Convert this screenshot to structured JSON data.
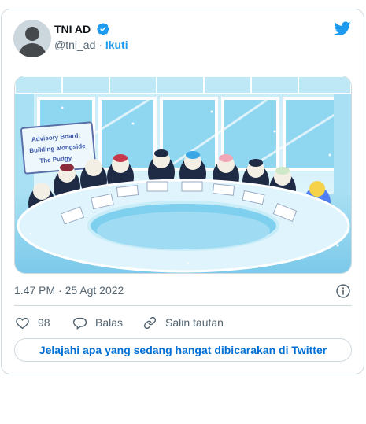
{
  "tweet": {
    "author_name": "TNI AD",
    "handle": "@tni_ad",
    "separator": "·",
    "follow_label": "Ikuti",
    "timestamp": "1.47 PM · 25 Agt 2022",
    "media": {
      "banner_text": [
        "Advisory Board:",
        "Building alongside",
        "The Pudgy"
      ]
    },
    "actions": {
      "likes_count": "98",
      "reply_label": "Balas",
      "copy_link_label": "Salin tautan"
    },
    "explore_label": "Jelajahi apa yang sedang hangat dibicarakan di Twitter"
  },
  "icons": {
    "verified": "verified-badge-icon",
    "logo": "twitter-bird-icon",
    "info": "info-icon",
    "like": "heart-icon",
    "reply": "speech-bubble-icon",
    "copy": "link-icon"
  },
  "colors": {
    "accent": "#1d9bf0",
    "link": "#006fd6",
    "secondary_text": "#536471",
    "border": "#cfd9de"
  }
}
